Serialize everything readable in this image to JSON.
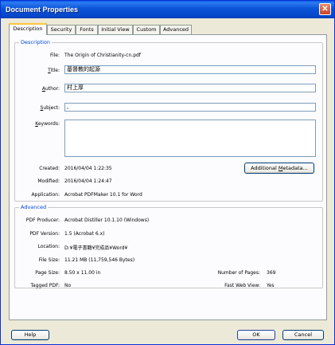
{
  "window": {
    "title": "Document Properties",
    "close_glyph": "✕"
  },
  "tabs": [
    {
      "label": "Description",
      "active": true
    },
    {
      "label": "Security",
      "active": false
    },
    {
      "label": "Fonts",
      "active": false
    },
    {
      "label": "Initial View",
      "active": false
    },
    {
      "label": "Custom",
      "active": false
    },
    {
      "label": "Advanced",
      "active": false
    }
  ],
  "description": {
    "group_label": "Description",
    "file_label": "File:",
    "file_value": "The Origin of Christianity-cn.pdf",
    "title_label": "Title:",
    "title_value": "基督教的起源",
    "author_label": "Author:",
    "author_value": "村上厚",
    "subject_label": "Subject:",
    "subject_value": ",",
    "keywords_label": "Keywords:",
    "keywords_value": "",
    "created_label": "Created:",
    "created_value": "2016/04/04 1:22:35",
    "modified_label": "Modified:",
    "modified_value": "2016/04/04 1:24:47",
    "application_label": "Application:",
    "application_value": "Acrobat PDFMaker 10.1 for Word",
    "additional_metadata_button": "Additional Metadata..."
  },
  "advanced": {
    "group_label": "Advanced",
    "producer_label": "PDF Producer:",
    "producer_value": "Acrobat Distiller 10.1.10 (Windows)",
    "version_label": "PDF Version:",
    "version_value": "1.5 (Acrobat 6.x)",
    "location_label": "Location:",
    "location_value": "D:¥電子書籍¥完成品¥Word¥",
    "filesize_label": "File Size:",
    "filesize_value": "11.21 MB (11,759,546 Bytes)",
    "pagesize_label": "Page Size:",
    "pagesize_value": "8.50 x 11.00 in",
    "numpages_label": "Number of Pages:",
    "numpages_value": "369",
    "tagged_label": "Tagged PDF:",
    "tagged_value": "No",
    "fastweb_label": "Fast Web View:",
    "fastweb_value": "Yes"
  },
  "footer": {
    "help_button": "Help",
    "ok_button": "OK",
    "cancel_button": "Cancel"
  }
}
